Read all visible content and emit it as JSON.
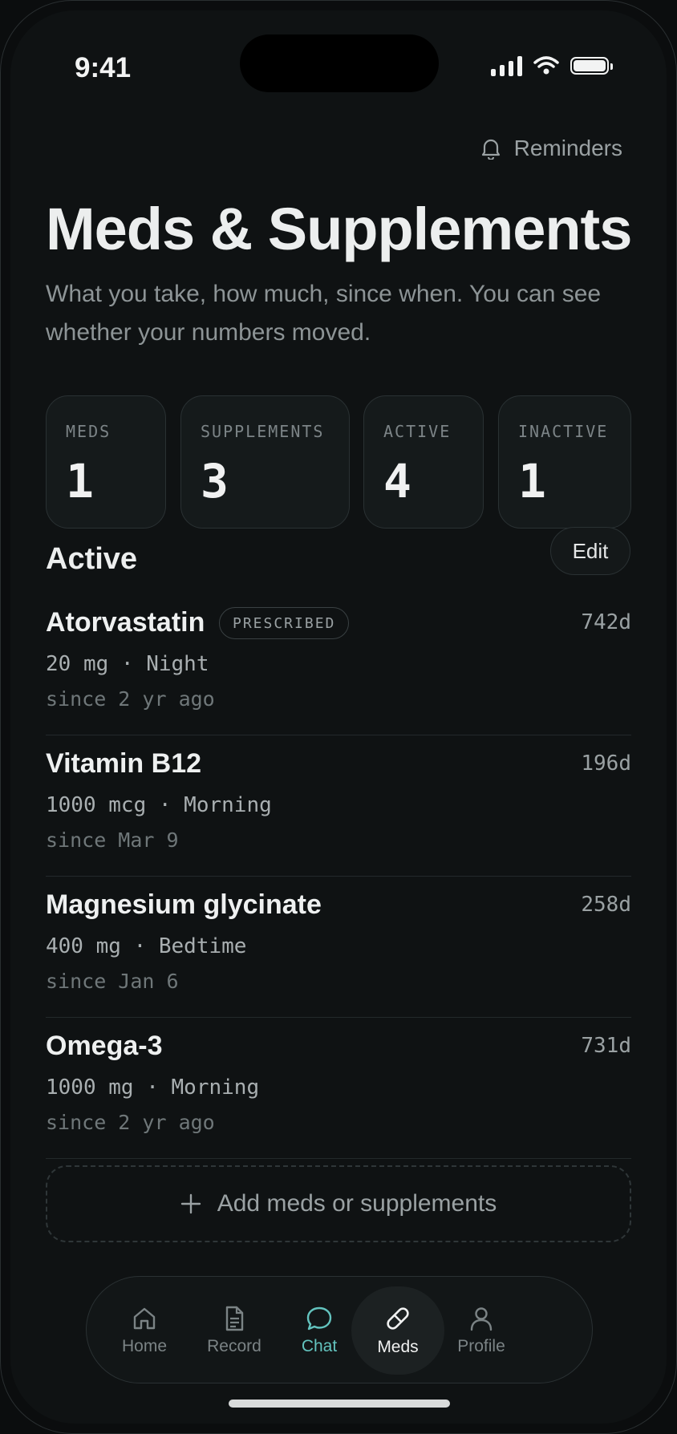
{
  "status": {
    "time": "9:41"
  },
  "header": {
    "reminders_label": "Reminders"
  },
  "page": {
    "title": "Meds & Supplements",
    "subtitle": "What you take, how much, since when. You can see whether your numbers moved."
  },
  "stats": [
    {
      "label": "MEDS",
      "value": "1"
    },
    {
      "label": "SUPPLEMENTS",
      "value": "3"
    },
    {
      "label": "ACTIVE",
      "value": "4"
    },
    {
      "label": "INACTIVE",
      "value": "1"
    }
  ],
  "active_section": {
    "title": "Active",
    "edit_label": "Edit",
    "items": [
      {
        "name": "Atorvastatin",
        "badge": "PRESCRIBED",
        "dose": "20 mg · Night",
        "since": "since 2 yr ago",
        "days": "742d"
      },
      {
        "name": "Vitamin B12",
        "dose": "1000 mcg · Morning",
        "since": "since Mar 9",
        "days": "196d"
      },
      {
        "name": "Magnesium glycinate",
        "dose": "400 mg · Bedtime",
        "since": "since Jan 6",
        "days": "258d"
      },
      {
        "name": "Omega-3",
        "dose": "1000 mg · Morning",
        "since": "since 2 yr ago",
        "days": "731d"
      }
    ]
  },
  "add_button": {
    "label": "Add meds or supplements"
  },
  "tabs": [
    {
      "label": "Home",
      "icon": "home-icon"
    },
    {
      "label": "Record",
      "icon": "document-icon"
    },
    {
      "label": "Chat",
      "icon": "chat-bubble-icon"
    },
    {
      "label": "Meds",
      "icon": "pill-icon",
      "selected": true
    },
    {
      "label": "Profile",
      "icon": "person-icon"
    }
  ],
  "colors": {
    "accent": "#63c3be",
    "background": "#0f1213",
    "card": "#151a1b"
  }
}
